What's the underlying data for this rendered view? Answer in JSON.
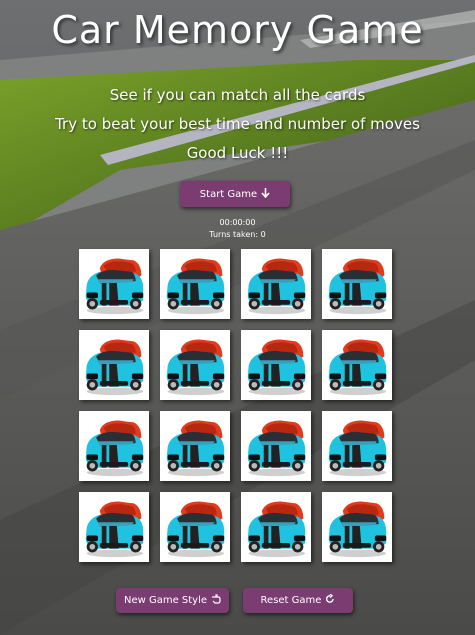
{
  "title": "Car Memory Game",
  "intro": {
    "line1": "See if you can match all the cards",
    "line2": "Try to beat your best time and number of moves",
    "line3": "Good Luck !!!"
  },
  "controls": {
    "start_label": "Start Game",
    "start_icon": "arrow-down-icon",
    "new_style_label": "New Game Style",
    "new_style_icon": "hand-pointer-icon",
    "reset_label": "Reset Game",
    "reset_icon": "rotate-icon"
  },
  "stats": {
    "timer": "00:00:00",
    "turns": "Turns taken: 0"
  },
  "board": {
    "card_face": "car-card-back",
    "cards": [
      1,
      2,
      3,
      4,
      5,
      6,
      7,
      8,
      9,
      10,
      11,
      12,
      13,
      14,
      15,
      16
    ]
  },
  "colors": {
    "button": "#7b3c72",
    "car_body": "#1fc3e0",
    "car_rear": "#e23a1c"
  }
}
